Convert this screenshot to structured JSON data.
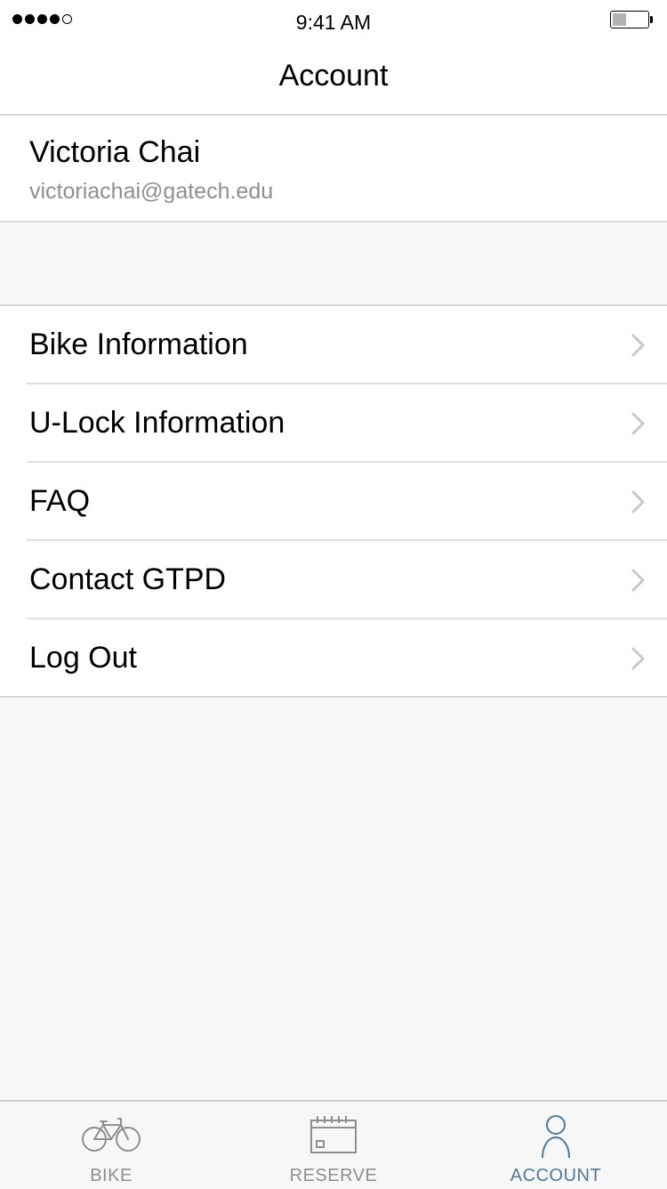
{
  "status_bar": {
    "time": "9:41 AM",
    "signal_bars_filled": 4,
    "signal_bars_total": 5,
    "battery_level": 0.4
  },
  "nav": {
    "title": "Account"
  },
  "profile": {
    "name": "Victoria Chai",
    "email": "victoriachai@gatech.edu"
  },
  "menu": {
    "items": [
      {
        "label": "Bike Information",
        "icon": "chevron-right-icon"
      },
      {
        "label": "U-Lock Information",
        "icon": "chevron-right-icon"
      },
      {
        "label": "FAQ",
        "icon": "chevron-right-icon"
      },
      {
        "label": "Contact GTPD",
        "icon": "chevron-right-icon"
      },
      {
        "label": "Log Out",
        "icon": "chevron-right-icon"
      }
    ]
  },
  "tab_bar": {
    "tabs": [
      {
        "label": "BIKE",
        "icon": "bike-icon",
        "active": false
      },
      {
        "label": "RESERVE",
        "icon": "calendar-icon",
        "active": false
      },
      {
        "label": "ACCOUNT",
        "icon": "person-icon",
        "active": true
      }
    ]
  },
  "colors": {
    "accent": "#4f7a9c",
    "inactive": "#8e8e93",
    "separator": "#d8d8d8",
    "background": "#f8f8f8"
  }
}
